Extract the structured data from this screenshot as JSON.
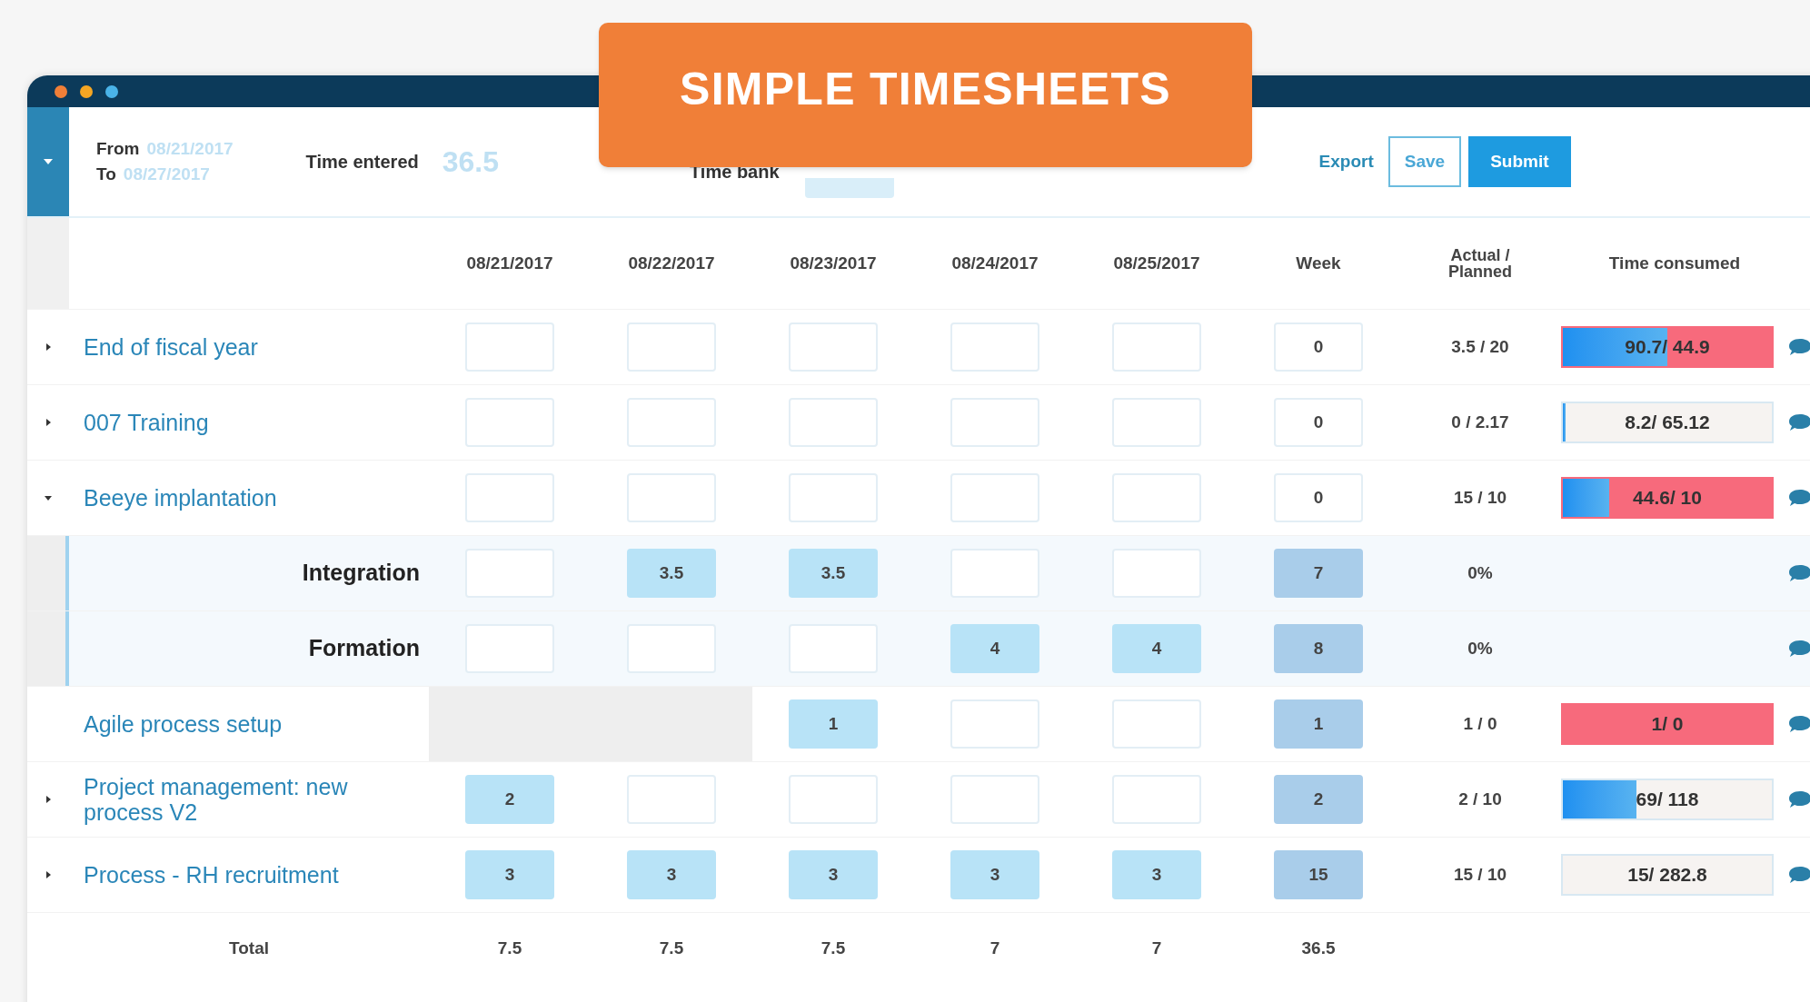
{
  "banner": {
    "title": "SIMPLE TIMESHEETS"
  },
  "header": {
    "from_label": "From",
    "from_date": "08/21/2017",
    "to_label": "To",
    "to_date": "08/27/2017",
    "time_entered_label": "Time entered",
    "time_entered": "36.5",
    "time_bank_label": "Time bank",
    "buttons": [
      {
        "label": "Export",
        "kind": "link"
      },
      {
        "label": "Save",
        "kind": "outline"
      },
      {
        "label": "Submit",
        "kind": "primary"
      }
    ]
  },
  "columns": [
    "08/21/2017",
    "08/22/2017",
    "08/23/2017",
    "08/24/2017",
    "08/25/2017",
    "Week",
    "Actual / Planned",
    "Time consumed"
  ],
  "rows": [
    {
      "kind": "task",
      "name": "End of fiscal year",
      "expanded": false,
      "cells": [
        {
          "locked": false
        },
        {
          "locked": false
        },
        {
          "locked": false
        },
        {
          "locked": false
        },
        {
          "locked": false
        }
      ],
      "week": {
        "value": "0",
        "highlighted": false
      },
      "actual": "3.5 / 20",
      "consumed": {
        "text": "90.7/ 44.9",
        "level": 0.5,
        "over": true
      }
    },
    {
      "kind": "task",
      "name": "007 Training",
      "expanded": false,
      "cells": [
        {
          "locked": false
        },
        {
          "locked": false
        },
        {
          "locked": false
        },
        {
          "locked": false
        },
        {
          "locked": false
        }
      ],
      "week": {
        "value": "0",
        "highlighted": false
      },
      "actual": "0 / 2.17",
      "consumed": {
        "text": "8.2/ 65.12",
        "level": 0.01,
        "over": false
      }
    },
    {
      "kind": "task",
      "name": "Beeye implantation",
      "expanded": true,
      "cells": [
        {
          "locked": false
        },
        {
          "locked": false
        },
        {
          "locked": false
        },
        {
          "locked": false
        },
        {
          "locked": false
        }
      ],
      "week": {
        "value": "0",
        "highlighted": false
      },
      "actual": "15 / 10",
      "consumed": {
        "text": "44.6/ 10",
        "level": 0.22,
        "over": true
      }
    },
    {
      "kind": "subtask",
      "name": "Integration",
      "cells": [
        {
          "locked": false
        },
        {
          "locked": false,
          "value": "3.5"
        },
        {
          "locked": false,
          "value": "3.5"
        },
        {
          "locked": false
        },
        {
          "locked": false
        }
      ],
      "week": {
        "value": "7",
        "highlighted": true
      },
      "actual": "0%"
    },
    {
      "kind": "subtask",
      "name": "Formation",
      "cells": [
        {
          "locked": false
        },
        {
          "locked": false
        },
        {
          "locked": false
        },
        {
          "locked": false,
          "value": "4"
        },
        {
          "locked": false,
          "value": "4"
        }
      ],
      "week": {
        "value": "8",
        "highlighted": true
      },
      "actual": "0%"
    },
    {
      "kind": "plain",
      "name": "Agile process setup",
      "cells": [
        {
          "locked": true
        },
        {
          "locked": true
        },
        {
          "locked": false,
          "value": "1"
        },
        {
          "locked": false
        },
        {
          "locked": false
        }
      ],
      "week": {
        "value": "1",
        "highlighted": true
      },
      "actual": "1 / 0",
      "consumed": {
        "text": "1/ 0",
        "level": 0,
        "over": true
      }
    },
    {
      "kind": "task",
      "name": "Project management: new process V2",
      "expanded": false,
      "cells": [
        {
          "locked": false,
          "value": "2"
        },
        {
          "locked": false
        },
        {
          "locked": false
        },
        {
          "locked": false
        },
        {
          "locked": false
        }
      ],
      "week": {
        "value": "2",
        "highlighted": true
      },
      "actual": "2 / 10",
      "consumed": {
        "text": "69/ 118",
        "level": 0.35,
        "over": false
      }
    },
    {
      "kind": "task",
      "name": "Process - RH recruitment",
      "expanded": false,
      "cells": [
        {
          "locked": false,
          "value": "3"
        },
        {
          "locked": false,
          "value": "3"
        },
        {
          "locked": false,
          "value": "3"
        },
        {
          "locked": false,
          "value": "3"
        },
        {
          "locked": false,
          "value": "3"
        }
      ],
      "week": {
        "value": "15",
        "highlighted": true
      },
      "actual": "15 / 10",
      "consumed": {
        "text": "15/ 282.8",
        "level": 0,
        "over": false
      }
    }
  ],
  "totals": {
    "label": "Total",
    "values": [
      "7.5",
      "7.5",
      "7.5",
      "7",
      "7",
      "36.5"
    ]
  }
}
